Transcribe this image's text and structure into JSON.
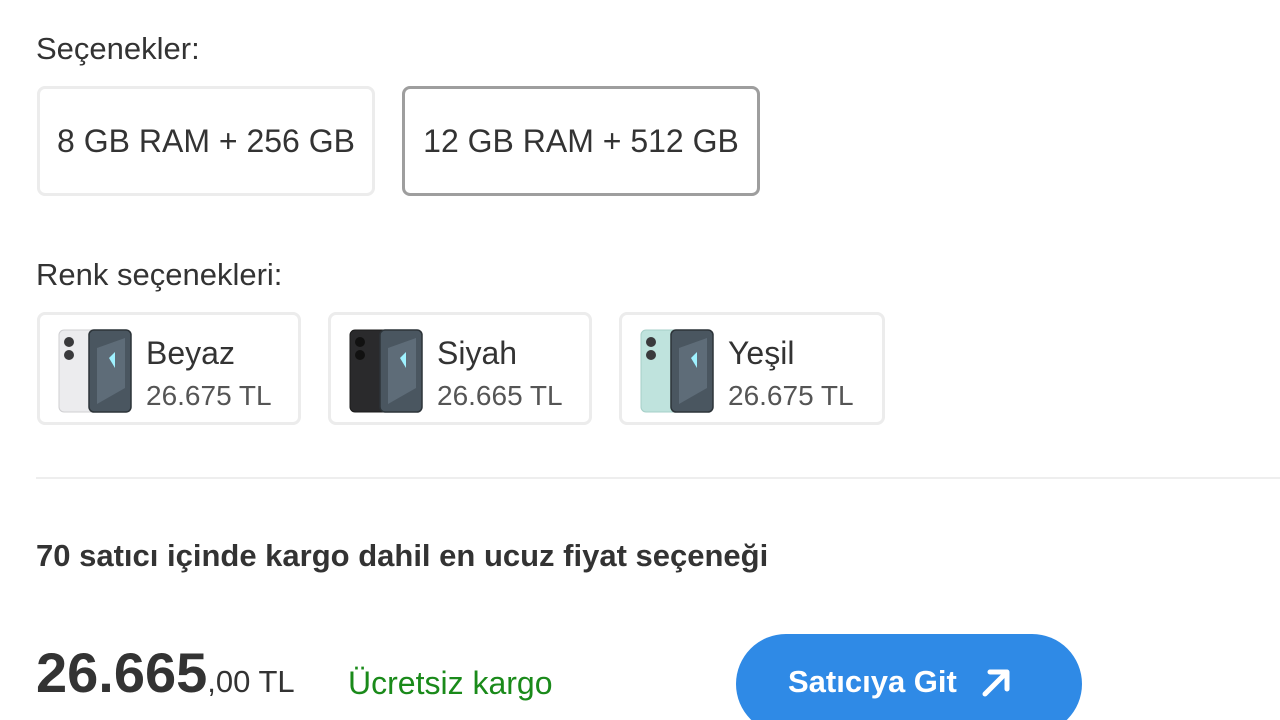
{
  "options": {
    "label": "Seçenekler:",
    "items": [
      {
        "label": "8 GB RAM + 256 GB",
        "selected": false
      },
      {
        "label": "12 GB RAM + 512 GB",
        "selected": true
      }
    ]
  },
  "colors": {
    "label": "Renk seçenekleri:",
    "items": [
      {
        "name": "Beyaz",
        "price": "26.675 TL",
        "swatch": "#e9e9eb",
        "icon": "phone-white-thumbnail"
      },
      {
        "name": "Siyah",
        "price": "26.665 TL",
        "swatch": "#2a2a2c",
        "icon": "phone-black-thumbnail"
      },
      {
        "name": "Yeşil",
        "price": "26.675 TL",
        "swatch": "#bfe3dd",
        "icon": "phone-green-thumbnail"
      }
    ]
  },
  "offer": {
    "title": "70 satıcı içinde kargo dahil en ucuz fiyat seçeneği",
    "price_main": "26.665",
    "price_decimal": ",00",
    "currency": " TL",
    "shipping": "Ücretsiz kargo",
    "cta_label": "Satıcıya Git",
    "cta_icon": "arrow-up-right-icon"
  },
  "theme": {
    "accent": "#2f8ae6",
    "shipping_green": "#1a8a1a",
    "selected_border": "#9e9e9e"
  }
}
